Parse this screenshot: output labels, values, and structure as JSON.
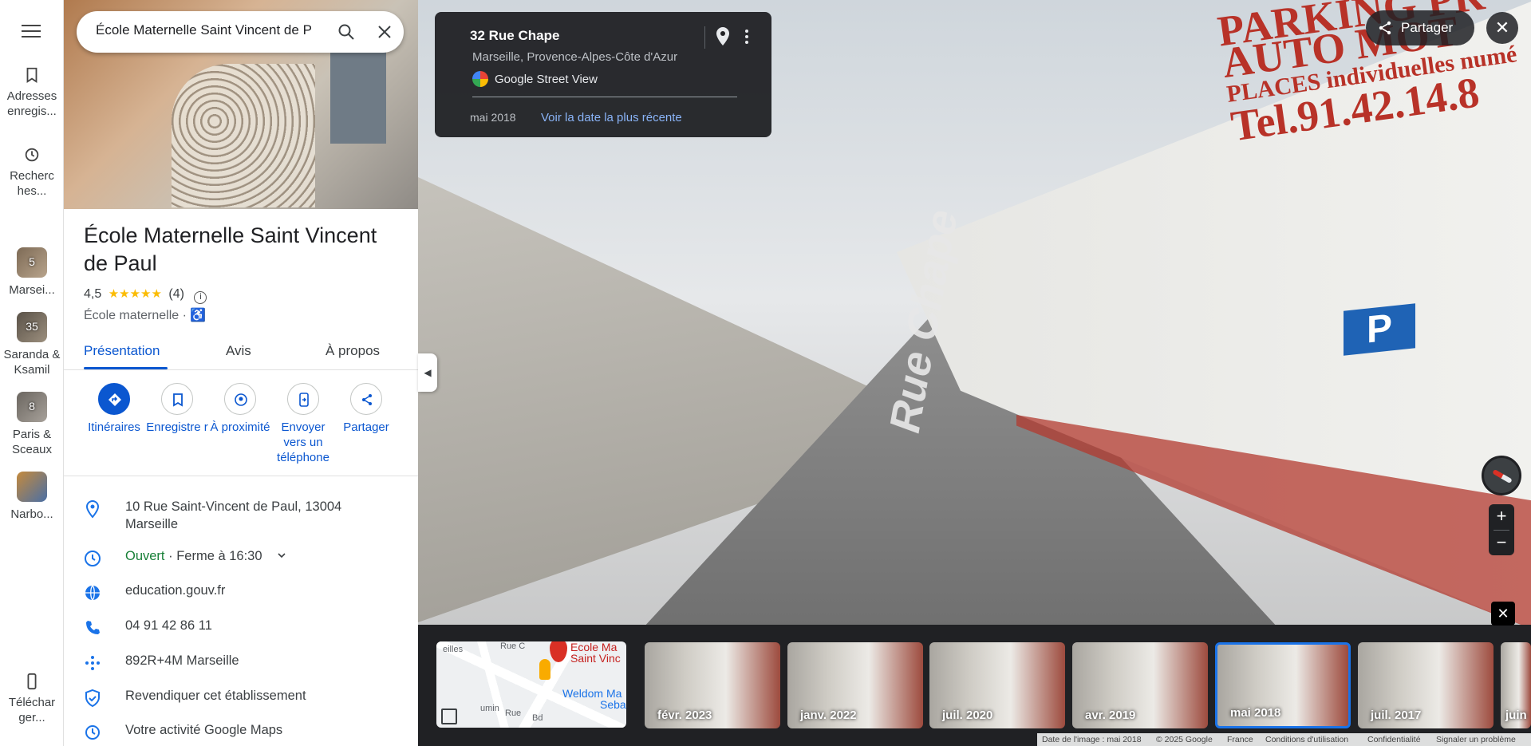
{
  "rail": {
    "saved_label": "Adresses enregis...",
    "recent_label": "Recherc hes...",
    "lists": [
      {
        "label": "Marsei...",
        "count": "5"
      },
      {
        "label": "Saranda & Ksamil",
        "count": "35"
      },
      {
        "label": "Paris & Sceaux",
        "count": "8"
      },
      {
        "label": "Narbo...",
        "count": ""
      }
    ],
    "download_label": "Téléchar ger..."
  },
  "search": {
    "value": "École Maternelle Saint Vincent de Pa"
  },
  "place": {
    "title": "École Maternelle Saint Vincent de Paul",
    "rating": "4,5",
    "stars": "★★★★★",
    "reviews": "(4)",
    "category": "École maternelle",
    "accessibility_icon": "wheelchair-icon"
  },
  "tabs": [
    "Présentation",
    "Avis",
    "À propos"
  ],
  "actions": [
    {
      "label": "Itinéraires",
      "icon": "directions-icon"
    },
    {
      "label": "Enregistre r",
      "icon": "bookmark-icon"
    },
    {
      "label": "À proximité",
      "icon": "nearby-icon"
    },
    {
      "label": "Envoyer vers un téléphone",
      "icon": "send-to-phone-icon"
    },
    {
      "label": "Partager",
      "icon": "share-icon"
    }
  ],
  "details": {
    "address": "10 Rue Saint-Vincent de Paul, 13004 Marseille",
    "open_status": "Ouvert",
    "hours": " · Ferme à 16:30",
    "website": "education.gouv.fr",
    "phone": "04 91 42 86 11",
    "plus_code": "892R+4M Marseille",
    "claim": "Revendiquer cet établissement",
    "activity": "Votre activité Google Maps"
  },
  "streetview": {
    "address": "32 Rue Chape",
    "region": "Marseille, Provence-Alpes-Côte d'Azur",
    "source": "Google Street View",
    "date": "mai 2018",
    "recent_link": "Voir la date la plus récente",
    "share_label": "Partager",
    "road_name": "Rue Chape",
    "sign_line1": "PARKING PR",
    "sign_line2": "AUTO   MOT",
    "sign_line3": "PLACES individuelles numé",
    "sign_line4": "Tel.91.42.14.8"
  },
  "minimap": {
    "place_line1": "Ecole Ma",
    "place_line2": "Saint Vinc",
    "poi_line1": "Weldom Ma",
    "poi_line2": "Seba",
    "street_a": "eilles",
    "street_b": "Rue C",
    "street_c": "umin",
    "street_d": "Rue",
    "street_e": "Bd"
  },
  "timeline": [
    {
      "label": "févr. 2023",
      "selected": false
    },
    {
      "label": "janv. 2022",
      "selected": false
    },
    {
      "label": "juil. 2020",
      "selected": false
    },
    {
      "label": "avr. 2019",
      "selected": false
    },
    {
      "label": "mai 2018",
      "selected": true
    },
    {
      "label": "juil. 2017",
      "selected": false
    },
    {
      "label": "juin",
      "selected": false
    }
  ],
  "footer": {
    "image_date": "Date de l'image : mai 2018",
    "copyright": "© 2025 Google",
    "country": "France",
    "terms": "Conditions d'utilisation",
    "privacy": "Confidentialité",
    "report": "Signaler un problème"
  },
  "colors": {
    "accent": "#0b57d0",
    "open_green": "#188038",
    "star": "#fbbc04",
    "selected_frame": "#1a73e8"
  }
}
